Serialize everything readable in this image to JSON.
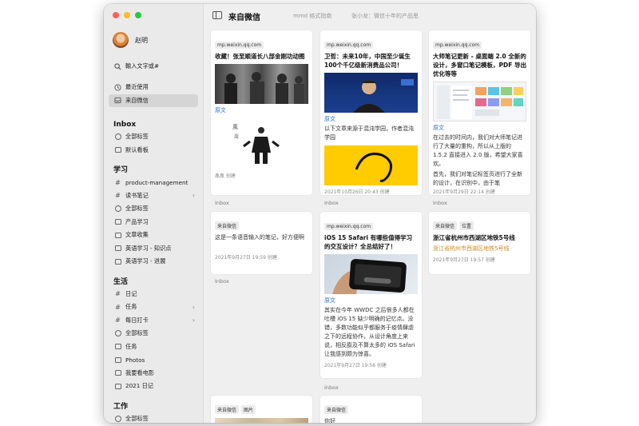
{
  "sidebar": {
    "user_name": "赵明",
    "search_placeholder": "輸入文字或#",
    "top_items": [
      {
        "label": "最近使用",
        "icon": "clock-icon"
      },
      {
        "label": "来自微信",
        "icon": "inbox-icon"
      }
    ],
    "sections": [
      {
        "title": "Inbox",
        "items": [
          {
            "label": "全部标签",
            "icon": "tag-circle-icon"
          },
          {
            "label": "默认看板",
            "icon": "board-icon"
          }
        ]
      },
      {
        "title": "学习",
        "items": [
          {
            "label": "product-management",
            "icon": "hash-icon"
          },
          {
            "label": "读书笔记",
            "icon": "hash-icon",
            "chevron": true
          },
          {
            "label": "全部标签",
            "icon": "tag-circle-icon"
          },
          {
            "label": "产品学习",
            "icon": "board-icon"
          },
          {
            "label": "文章收集",
            "icon": "board-icon"
          },
          {
            "label": "英语学习 - 知识点",
            "icon": "board-icon"
          },
          {
            "label": "英语学习 - 进展",
            "icon": "board-icon"
          }
        ]
      },
      {
        "title": "生活",
        "items": [
          {
            "label": "日记",
            "icon": "hash-icon"
          },
          {
            "label": "任务",
            "icon": "hash-icon",
            "chevron": true
          },
          {
            "label": "每日打卡",
            "icon": "hash-icon",
            "chevron": true
          },
          {
            "label": "全部标签",
            "icon": "tag-circle-icon"
          },
          {
            "label": "任务",
            "icon": "board-icon"
          },
          {
            "label": "Photos",
            "icon": "board-icon"
          },
          {
            "label": "我要看电影",
            "icon": "board-icon"
          },
          {
            "label": "2021 日记",
            "icon": "board-icon"
          }
        ]
      },
      {
        "title": "工作",
        "items": [
          {
            "label": "全部标签",
            "icon": "tag-circle-icon"
          }
        ]
      }
    ]
  },
  "header": {
    "title": "来自微信",
    "ghost_tabs": [
      "mmd 格式指南",
      "张小龙：微信十年的产品思"
    ]
  },
  "cards": {
    "c1": {
      "tag": "mp.weixin.qq.com",
      "title": "收藏！张至顺道长八部金刚功动图",
      "link": "原文",
      "meta": "胤胤 创建"
    },
    "c2": {
      "tag": "mp.weixin.qq.com",
      "title": "卫哲：未来10年，中国至少诞生100个千亿级新消费品公司！",
      "link": "原文",
      "text": "以下文章来源于混沌学园，作者混沌学园",
      "meta": "2021年10月26日 20:43 创建"
    },
    "c3": {
      "tag": "mp.weixin.qq.com",
      "title": "大师笔记更新 - 桌面端 2.0 全新的设计，多窗口笔记模板，PDF 导出优化等等",
      "link": "原文",
      "text": "在过去的时间内，我们对大师笔记进行了大量的重构，所以从上版的 1.5.2 直接进入 2.0 版，希望大家喜欢。",
      "text2": "首先，我们对笔记标签页进行了全新的设计，在识别中，由于笔",
      "meta": "2021年9月29日 22:14 创建"
    },
    "c4": {
      "tag": "来自微信",
      "text": "这是一条语音输入的笔记，好方便啊",
      "meta": "2021年9月27日 19:59 创建"
    },
    "c5": {
      "tag": "mp.weixin.qq.com",
      "title": "iOS 15 Safari 有哪些值得学习的交互设计？全总结好了！",
      "link": "原文",
      "text": "其实在今年 WWDC 之后很多人都在吐槽 iOS 15 缺少明确的记忆点。没错，多数功能似乎都服务于疫情肆虐之下的远程协作，从设计角度上来说，相反膨及不算太多的 iOS Safari 让我感到颇为惊喜。",
      "meta": "2021年9月27日 19:58 创建"
    },
    "c6": {
      "tags": [
        "来自微信",
        "位置"
      ],
      "title": "浙江省杭州市西湖区地铁5号线",
      "orange": "浙江省杭州市西湖区地铁5号线",
      "meta": "2021年9月27日 19:57 创建"
    },
    "c7": {
      "tags": [
        "来自微信",
        "图片"
      ]
    },
    "c8": {
      "tag": "来自微信",
      "text": "你好"
    }
  },
  "inbox_label": "Inbox",
  "colors": {
    "link": "#2a6fd6",
    "location": "#d08a20",
    "active_nav": "#d6d5d5"
  }
}
